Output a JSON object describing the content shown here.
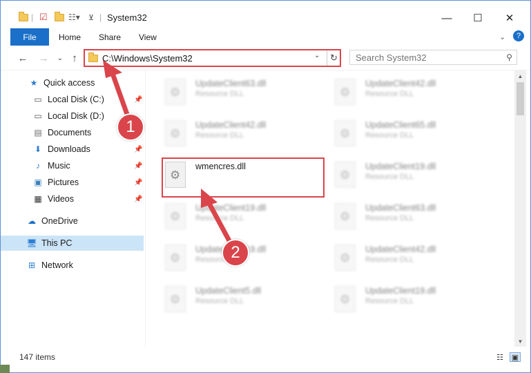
{
  "window": {
    "title": "System32",
    "minimize_glyph": "—",
    "maximize_glyph": "☐",
    "close_glyph": "✕"
  },
  "ribbon": {
    "tabs": [
      {
        "label": "File"
      },
      {
        "label": "Home"
      },
      {
        "label": "Share"
      },
      {
        "label": "View"
      }
    ],
    "help_glyph": "?"
  },
  "address": {
    "path": "C:\\Windows\\System32",
    "refresh_glyph": "↻",
    "dropdown_glyph": "⌄"
  },
  "search": {
    "placeholder": "Search System32"
  },
  "nav": {
    "items": [
      {
        "label": "Quick access",
        "icon": "star-icon",
        "pinned": false
      },
      {
        "label": "Local Disk (C:)",
        "icon": "drive-icon",
        "pinned": true
      },
      {
        "label": "Local Disk (D:)",
        "icon": "drive-icon",
        "pinned": true
      },
      {
        "label": "Documents",
        "icon": "documents-icon",
        "pinned": true
      },
      {
        "label": "Downloads",
        "icon": "downloads-icon",
        "pinned": true
      },
      {
        "label": "Music",
        "icon": "music-icon",
        "pinned": true
      },
      {
        "label": "Pictures",
        "icon": "pictures-icon",
        "pinned": true
      },
      {
        "label": "Videos",
        "icon": "videos-icon",
        "pinned": true
      },
      {
        "label": "OneDrive",
        "icon": "cloud-icon",
        "pinned": false
      },
      {
        "label": "This PC",
        "icon": "computer-icon",
        "pinned": false,
        "selected": true
      },
      {
        "label": "Network",
        "icon": "network-icon",
        "pinned": false
      }
    ]
  },
  "files": [
    {
      "name": "UpdateClient63.dll",
      "type": "Resource DLL",
      "blurred": true
    },
    {
      "name": "UpdateClient42.dll",
      "type": "Resource DLL",
      "blurred": true
    },
    {
      "name": "UpdateClient42.dll",
      "type": "Resource DLL",
      "blurred": true
    },
    {
      "name": "UpdateClient65.dll",
      "type": "Resource DLL",
      "blurred": true
    },
    {
      "name": "wmencres.dll",
      "type": "",
      "blurred": false
    },
    {
      "name": "UpdateClient19.dll",
      "type": "Resource DLL",
      "blurred": true
    },
    {
      "name": "UpdateClient19.dll",
      "type": "Resource DLL",
      "blurred": true
    },
    {
      "name": "UpdateClient63.dll",
      "type": "Resource DLL",
      "blurred": true
    },
    {
      "name": "UpdateClient19.dll",
      "type": "Resource DLL",
      "blurred": true
    },
    {
      "name": "UpdateClient42.dll",
      "type": "Resource DLL",
      "blurred": true
    },
    {
      "name": "UpdateClient5.dll",
      "type": "Resource DLL",
      "blurred": true
    },
    {
      "name": "UpdateClient19.dll",
      "type": "Resource DLL",
      "blurred": true
    }
  ],
  "status": {
    "item_count": "147 items"
  },
  "callouts": {
    "one": "1",
    "two": "2"
  },
  "colors": {
    "accent": "#1a6fc9",
    "highlight": "#d9454b",
    "selection": "#cce4f7"
  }
}
